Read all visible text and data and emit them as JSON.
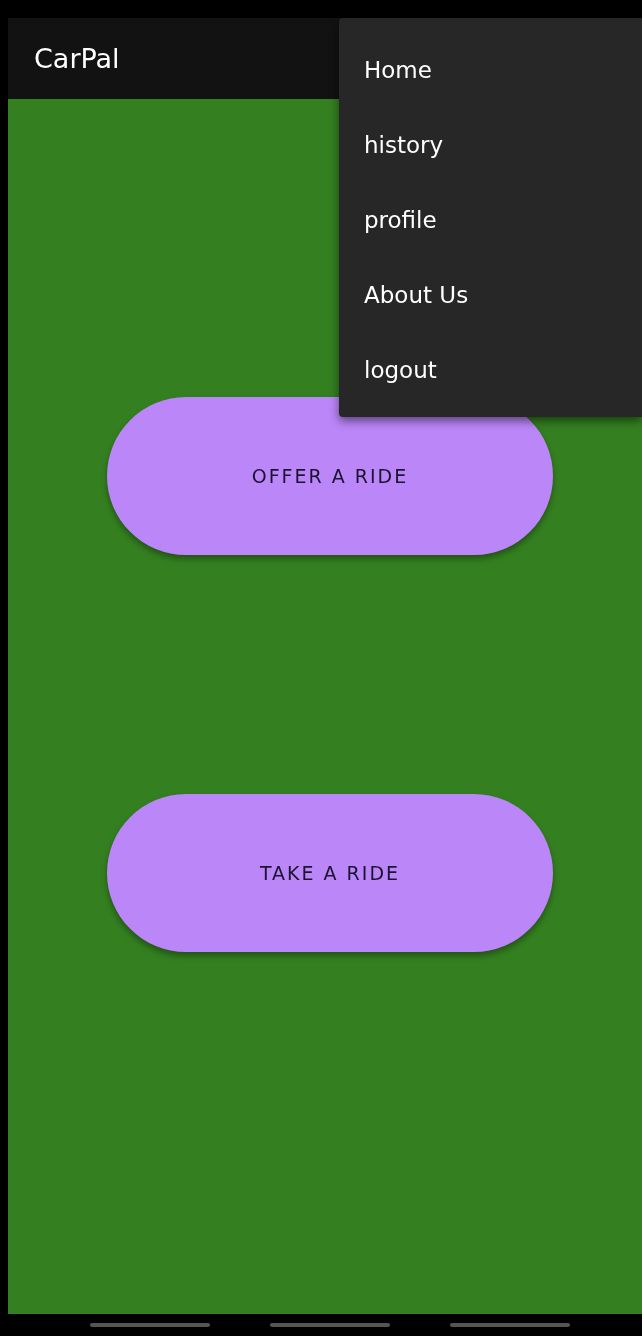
{
  "app_bar": {
    "title": "CarPal"
  },
  "menu": {
    "items": [
      {
        "label": "Home"
      },
      {
        "label": "history"
      },
      {
        "label": "profile"
      },
      {
        "label": "About Us"
      },
      {
        "label": "logout"
      }
    ]
  },
  "buttons": [
    {
      "label": "OFFER A RIDE"
    },
    {
      "label": "TAKE A RIDE"
    }
  ]
}
